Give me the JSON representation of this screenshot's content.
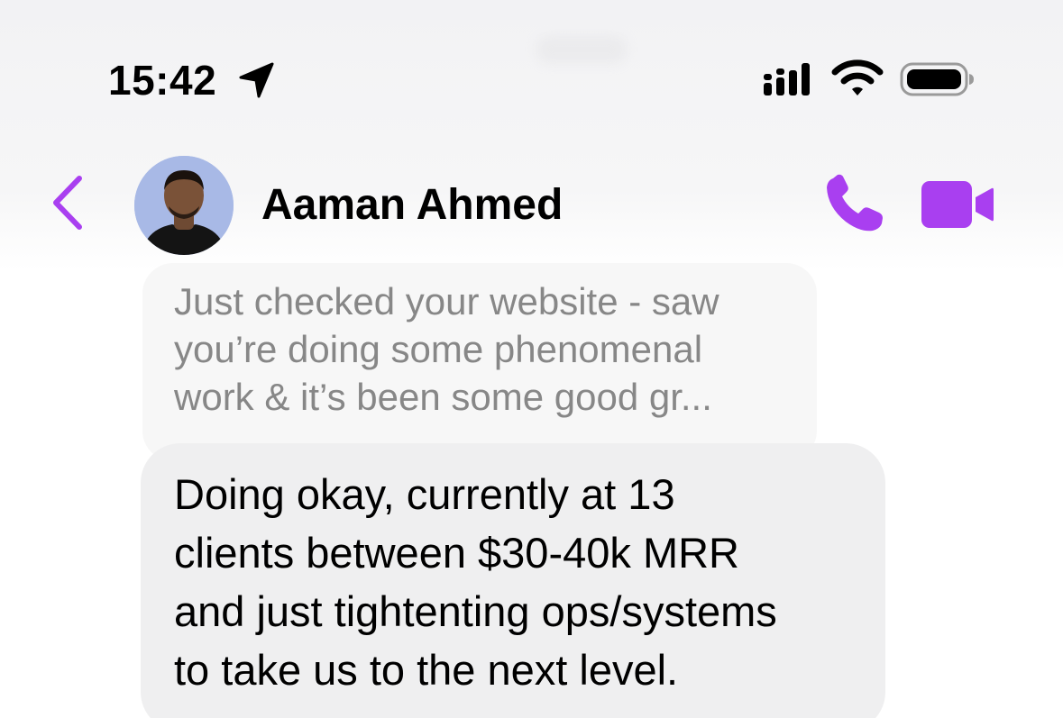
{
  "status_bar": {
    "time": "15:42",
    "icons": [
      "location-arrow-icon",
      "signal-icon",
      "wifi-icon",
      "battery-icon"
    ]
  },
  "header": {
    "back_icon": "chevron-left-icon",
    "contact_name": "Aaman Ahmed",
    "actions": [
      "phone-call-icon",
      "video-camera-icon"
    ]
  },
  "messages": {
    "reply_preview_lines": [
      "Just checked your website - saw",
      "you’re doing some phenomenal",
      "work & it’s been some good gr..."
    ],
    "received_message_lines": [
      "Doing okay, currently at 13",
      "clients between $30-40k MRR",
      "and just tightenting ops/systems",
      "to take us to the next level."
    ]
  },
  "colors": {
    "accent": "#a93ff0",
    "bubble_background": "#efeff0",
    "reply_preview_background": "#f7f7f7",
    "reply_text": "#878787",
    "text": "#000000"
  }
}
